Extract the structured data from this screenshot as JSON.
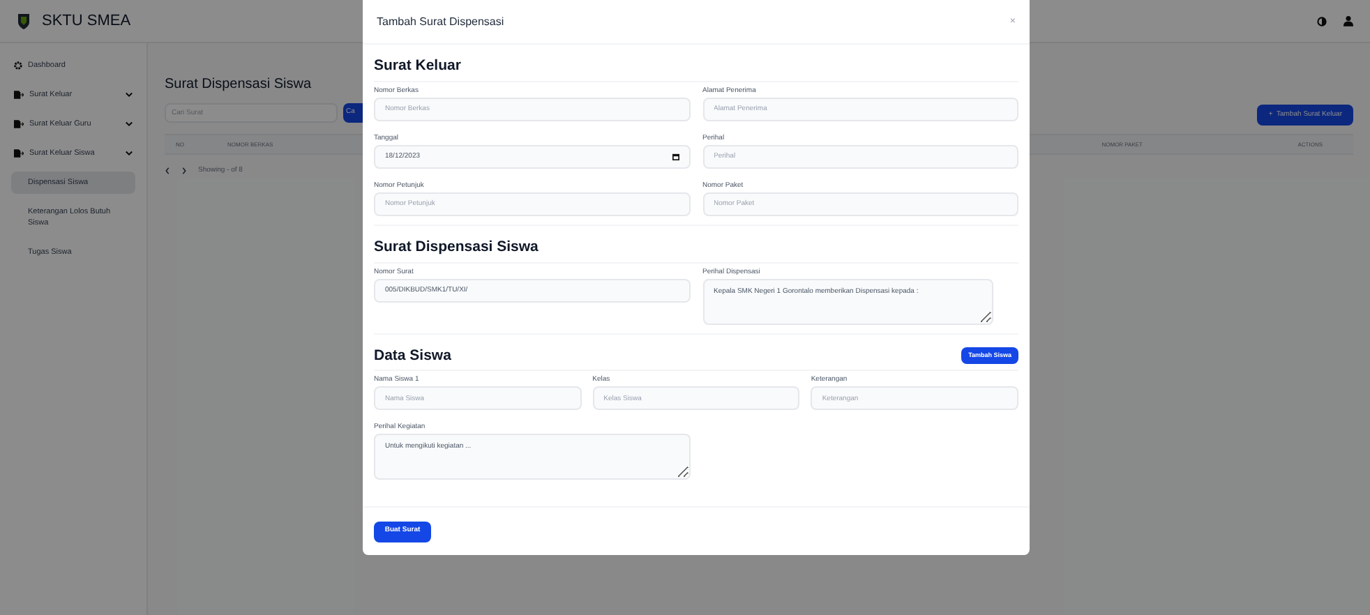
{
  "app": {
    "title": "SKTU SMEA"
  },
  "sidebar": {
    "items": [
      {
        "label": "Dashboard",
        "kind": "link"
      },
      {
        "label": "Surat Keluar",
        "kind": "group"
      },
      {
        "label": "Surat Keluar Guru",
        "kind": "group"
      },
      {
        "label": "Surat Keluar Siswa",
        "kind": "group",
        "children": [
          {
            "label": "Dispensasi Siswa",
            "selected": true
          },
          {
            "label": "Keterangan Lolos Butuh Siswa",
            "selected": false
          },
          {
            "label": "Tugas Siswa",
            "selected": false
          }
        ]
      }
    ]
  },
  "main": {
    "title": "Surat Dispensasi Siswa",
    "search": {
      "placeholder": "Cari Surat"
    },
    "search_button": "Ca",
    "add_button": "+  Tambah Surat Keluar",
    "table": {
      "columns": [
        "NO",
        "NOMOR BERKAS",
        "NOMOR PAKET",
        "ACTIONS"
      ]
    },
    "pagination": "Showing - of 8"
  },
  "modal": {
    "title": "Tambah Surat Dispensasi",
    "close": "×",
    "sections": [
      {
        "title": "Surat Keluar",
        "rows": [
          [
            {
              "label": "Nomor Berkas",
              "kind": "input",
              "placeholder": "Nomor Berkas"
            },
            {
              "label": "Alamat Penerima",
              "kind": "input",
              "placeholder": "Alamat Penerima"
            }
          ],
          [
            {
              "label": "Tanggal",
              "kind": "date",
              "value": "18/12/2023"
            },
            {
              "label": "Perihal",
              "kind": "input",
              "placeholder": "Perihal"
            }
          ],
          [
            {
              "label": "Nomor Petunjuk",
              "kind": "input",
              "placeholder": "Nomor Petunjuk"
            },
            {
              "label": "Nomor Paket",
              "kind": "input",
              "placeholder": "Nomor Paket"
            }
          ]
        ]
      },
      {
        "title": "Surat Dispensasi Siswa",
        "rows": [
          [
            {
              "label": "Nomor Surat",
              "kind": "input",
              "value": "005/DIKBUD/SMK1/TU/XI/"
            },
            {
              "label": "Perihal Dispensasi",
              "kind": "textarea",
              "value": "Kepala SMK Negeri 1 Gorontalo memberikan Dispensasi kepada :"
            }
          ]
        ]
      },
      {
        "title": "Data Siswa",
        "action": "Tambah Siswa",
        "rows": [
          [
            {
              "label": "Nama Siswa 1",
              "kind": "input",
              "placeholder": "Nama Siswa"
            },
            {
              "label": "Kelas",
              "kind": "input",
              "placeholder": "Kelas Siswa"
            },
            {
              "label": "Keterangan",
              "kind": "input",
              "placeholder": "Keterangan"
            }
          ],
          [
            {
              "label": "Perihal Kegiatan",
              "kind": "textarea",
              "value": "Untuk mengikuti kegiatan ..."
            }
          ]
        ]
      }
    ],
    "submit": "Buat Surat"
  }
}
